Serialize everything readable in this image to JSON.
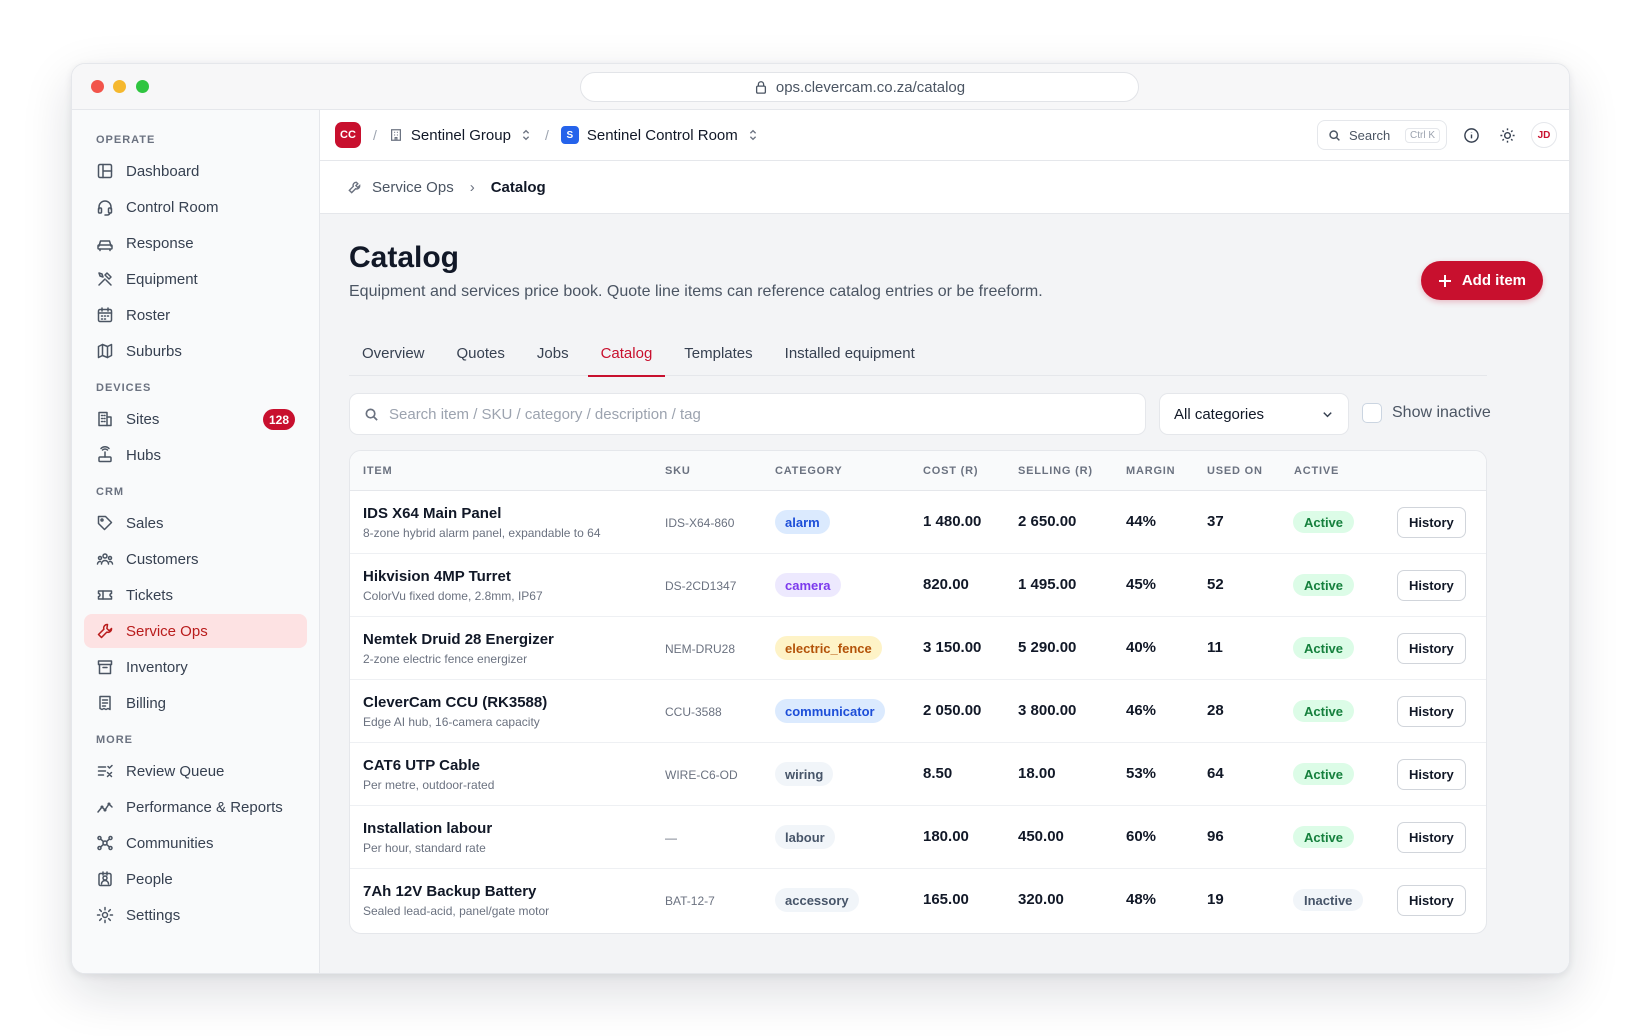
{
  "browser": {
    "url": "ops.clevercam.co.za/catalog"
  },
  "sidebar": {
    "sections": [
      {
        "label": "OPERATE",
        "items": [
          {
            "label": "Dashboard",
            "icon": "layout-icon"
          },
          {
            "label": "Control Room",
            "icon": "headset-icon"
          },
          {
            "label": "Response",
            "icon": "car-icon"
          },
          {
            "label": "Equipment",
            "icon": "tools-icon"
          },
          {
            "label": "Roster",
            "icon": "calendar-icon"
          },
          {
            "label": "Suburbs",
            "icon": "map-icon"
          }
        ]
      },
      {
        "label": "DEVICES",
        "items": [
          {
            "label": "Sites",
            "icon": "building-icon",
            "badge": "128"
          },
          {
            "label": "Hubs",
            "icon": "hub-icon"
          }
        ]
      },
      {
        "label": "CRM",
        "items": [
          {
            "label": "Sales",
            "icon": "tag-icon"
          },
          {
            "label": "Customers",
            "icon": "users-icon"
          },
          {
            "label": "Tickets",
            "icon": "ticket-icon"
          },
          {
            "label": "Service Ops",
            "icon": "wrench-icon",
            "active": true
          },
          {
            "label": "Inventory",
            "icon": "archive-icon"
          },
          {
            "label": "Billing",
            "icon": "receipt-icon"
          }
        ]
      },
      {
        "label": "MORE",
        "items": [
          {
            "label": "Review Queue",
            "icon": "list-check-icon"
          },
          {
            "label": "Performance & Reports",
            "icon": "trend-icon"
          },
          {
            "label": "Communities",
            "icon": "network-icon"
          },
          {
            "label": "People",
            "icon": "id-card-icon"
          },
          {
            "label": "Settings",
            "icon": "gear-icon"
          }
        ]
      }
    ]
  },
  "topbar": {
    "org_initials": "CC",
    "org_name": "Sentinel Group",
    "site_initial": "S",
    "site_name": "Sentinel Control Room",
    "search_label": "Search",
    "search_shortcut": "Ctrl K",
    "user_initials": "JD"
  },
  "breadcrumb": {
    "parent": "Service Ops",
    "current": "Catalog"
  },
  "page": {
    "title": "Catalog",
    "description": "Equipment and services price book. Quote line items can reference catalog entries or be freeform.",
    "add_button": "Add item"
  },
  "tabs": [
    {
      "label": "Overview"
    },
    {
      "label": "Quotes"
    },
    {
      "label": "Jobs"
    },
    {
      "label": "Catalog",
      "active": true
    },
    {
      "label": "Templates"
    },
    {
      "label": "Installed equipment"
    }
  ],
  "filters": {
    "search_placeholder": "Search item / SKU / category / description / tag",
    "category_value": "All categories",
    "show_inactive_label": "Show inactive"
  },
  "table": {
    "headers": {
      "item": "ITEM",
      "sku": "SKU",
      "category": "CATEGORY",
      "cost": "COST (R)",
      "selling": "SELLING (R)",
      "margin": "MARGIN",
      "used_on": "USED ON",
      "active": "ACTIVE"
    },
    "history_label": "History",
    "category_colors": {
      "alarm": {
        "bg": "#dbeafe",
        "fg": "#1d4ed8"
      },
      "camera": {
        "bg": "#ede9fe",
        "fg": "#7c3aed"
      },
      "electric_fence": {
        "bg": "#fef3c7",
        "fg": "#b45309"
      },
      "communicator": {
        "bg": "#dbeafe",
        "fg": "#1d4ed8"
      },
      "wiring": {
        "bg": "#f1f5f9",
        "fg": "#475569"
      },
      "labour": {
        "bg": "#f1f5f9",
        "fg": "#475569"
      },
      "accessory": {
        "bg": "#f1f5f9",
        "fg": "#475569"
      }
    },
    "status_colors": {
      "Active": {
        "bg": "#dcfce7",
        "fg": "#15803d"
      },
      "Inactive": {
        "bg": "#f1f5f9",
        "fg": "#475569"
      }
    },
    "rows": [
      {
        "name": "IDS X64 Main Panel",
        "desc": "8-zone hybrid alarm panel, expandable to 64",
        "sku": "IDS-X64-860",
        "category": "alarm",
        "cost": "1 480.00",
        "selling": "2 650.00",
        "margin": "44%",
        "used_on": "37",
        "status": "Active"
      },
      {
        "name": "Hikvision 4MP Turret",
        "desc": "ColorVu fixed dome, 2.8mm, IP67",
        "sku": "DS-2CD1347",
        "category": "camera",
        "cost": "820.00",
        "selling": "1 495.00",
        "margin": "45%",
        "used_on": "52",
        "status": "Active"
      },
      {
        "name": "Nemtek Druid 28 Energizer",
        "desc": "2-zone electric fence energizer",
        "sku": "NEM-DRU28",
        "category": "electric_fence",
        "cost": "3 150.00",
        "selling": "5 290.00",
        "margin": "40%",
        "used_on": "11",
        "status": "Active"
      },
      {
        "name": "CleverCam CCU (RK3588)",
        "desc": "Edge AI hub, 16-camera capacity",
        "sku": "CCU-3588",
        "category": "communicator",
        "cost": "2 050.00",
        "selling": "3 800.00",
        "margin": "46%",
        "used_on": "28",
        "status": "Active"
      },
      {
        "name": "CAT6 UTP Cable",
        "desc": "Per metre, outdoor-rated",
        "sku": "WIRE-C6-OD",
        "category": "wiring",
        "cost": "8.50",
        "selling": "18.00",
        "margin": "53%",
        "used_on": "64",
        "status": "Active"
      },
      {
        "name": "Installation labour",
        "desc": "Per hour, standard rate",
        "sku": "—",
        "category": "labour",
        "cost": "180.00",
        "selling": "450.00",
        "margin": "60%",
        "used_on": "96",
        "status": "Active"
      },
      {
        "name": "7Ah 12V Backup Battery",
        "desc": "Sealed lead-acid, panel/gate motor",
        "sku": "BAT-12-7",
        "category": "accessory",
        "cost": "165.00",
        "selling": "320.00",
        "margin": "48%",
        "used_on": "19",
        "status": "Inactive"
      }
    ]
  }
}
